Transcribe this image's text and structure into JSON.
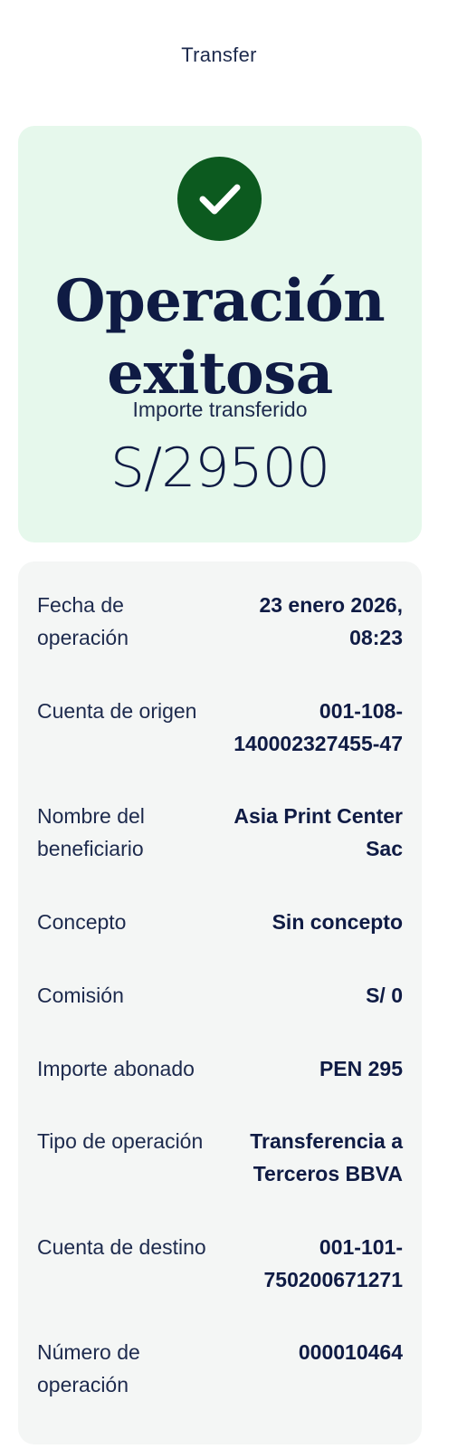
{
  "header": {
    "title": "Transfer"
  },
  "success": {
    "title_line1": "Operación",
    "title_line2": "exitosa",
    "amount_label": "Importe transferido",
    "amount": "S/29500",
    "accent_color": "#0c5a1f",
    "card_color": "#e6f8ec",
    "icon": "check-icon"
  },
  "details": [
    {
      "label": "Fecha de operación",
      "value": "23 enero 2026, 08:23"
    },
    {
      "label": "Cuenta de origen",
      "value": "001-108-140002327455-47"
    },
    {
      "label": "Nombre del beneficiario",
      "value": "Asia Print Center Sac"
    },
    {
      "label": "Concepto",
      "value": "Sin concepto"
    },
    {
      "label": "Comisión",
      "value": "S/ 0"
    },
    {
      "label": "Importe abonado",
      "value": "PEN 295"
    },
    {
      "label": "Tipo de operación",
      "value": "Transferencia a Terceros BBVA"
    },
    {
      "label": "Cuenta de destino",
      "value": "001-101-750200671271"
    },
    {
      "label": "Número de operación",
      "value": "000010464"
    }
  ]
}
